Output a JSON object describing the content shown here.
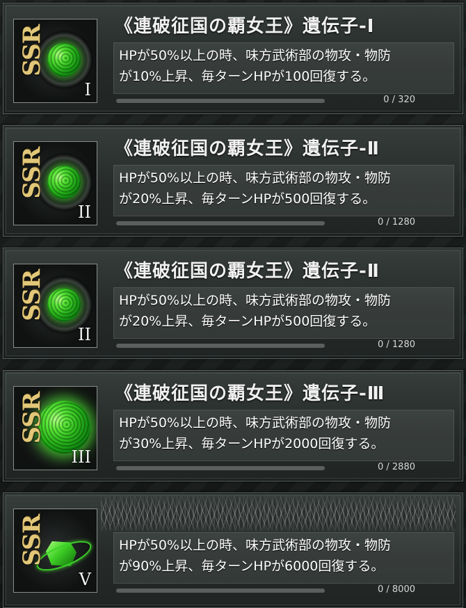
{
  "cards": [
    {
      "ssr": "SSR",
      "roman": "I",
      "title": "《連破征国の覇女王》遺伝子-Ⅰ",
      "desc_line1": "HPが50%以上の時、味方武術部の物攻・物防",
      "desc_line2": "が10%上昇、毎ターンHPが100回復する。",
      "progress": 0,
      "count": "0 / 320",
      "icon": "gene-orb-icon"
    },
    {
      "ssr": "SSR",
      "roman": "II",
      "title": "《連破征国の覇女王》遺伝子-Ⅱ",
      "desc_line1": "HPが50%以上の時、味方武術部の物攻・物防",
      "desc_line2": "が20%上昇、毎ターンHPが500回復する。",
      "progress": 0,
      "count": "0 / 1280",
      "icon": "gene-orb-icon"
    },
    {
      "ssr": "SSR",
      "roman": "II",
      "title": "《連破征国の覇女王》遺伝子-Ⅱ",
      "desc_line1": "HPが50%以上の時、味方武術部の物攻・物防",
      "desc_line2": "が20%上昇、毎ターンHPが500回復する。",
      "progress": 0,
      "count": "0 / 1280",
      "icon": "gene-orb-icon"
    },
    {
      "ssr": "SSR",
      "roman": "III",
      "title": "《連破征国の覇女王》遺伝子-Ⅲ",
      "desc_line1": "HPが50%以上の時、味方武術部の物攻・物防",
      "desc_line2": "が30%上昇、毎ターンHPが2000回復する。",
      "progress": 0,
      "count": "0 / 2880",
      "icon": "glowing-gene-orb-icon"
    },
    {
      "ssr": "SSR",
      "roman": "V",
      "title": "",
      "desc_line1": "HPが50%以上の時、味方武術部の物攻・物防",
      "desc_line2": "が90%上昇、毎ターンHPが6000回復する。",
      "progress": 0,
      "count": "0 / 8000",
      "icon": "gene-crystal-icon"
    }
  ]
}
